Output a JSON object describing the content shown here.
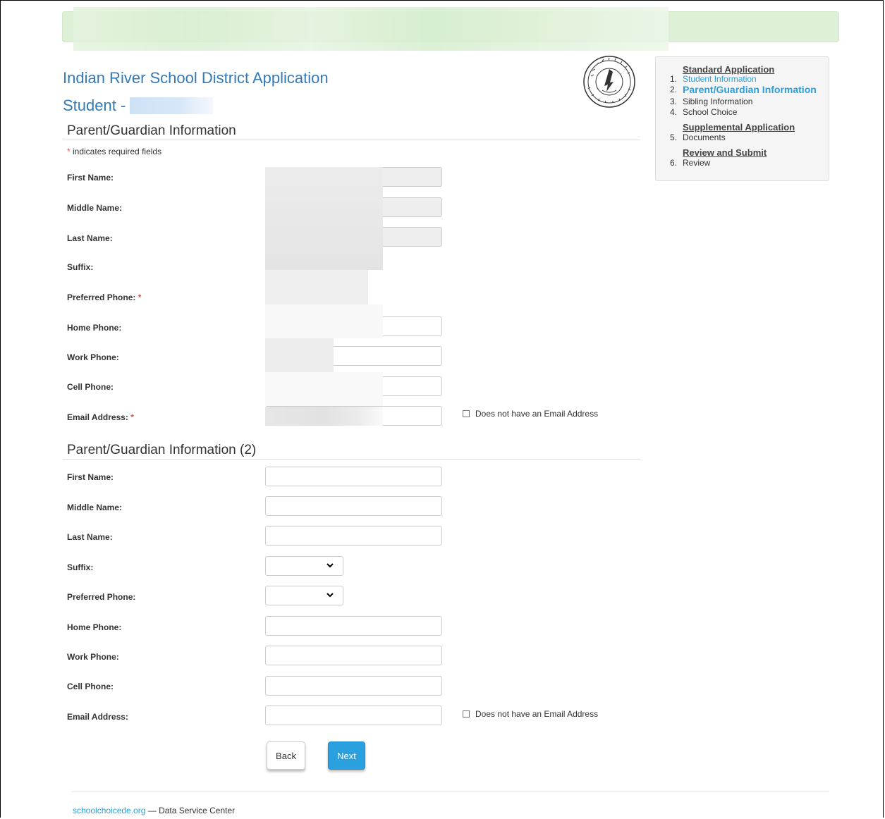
{
  "app": {
    "title": "Indian River School District Application",
    "student_prefix": "Student -"
  },
  "form": {
    "required_note_star": "*",
    "required_note_text": " indicates required fields",
    "section1": {
      "title": "Parent/Guardian Information",
      "labels": {
        "first_name": "First Name:",
        "middle_name": "Middle Name:",
        "last_name": "Last Name:",
        "suffix": "Suffix:",
        "preferred_phone": "Preferred Phone:",
        "home_phone": "Home Phone:",
        "work_phone": "Work Phone:",
        "cell_phone": "Cell Phone:",
        "email": "Email Address:"
      },
      "required_star": "*",
      "no_email_label": "Does not have an Email Address"
    },
    "section2": {
      "title": "Parent/Guardian Information (2)",
      "labels": {
        "first_name": "First Name:",
        "middle_name": "Middle Name:",
        "last_name": "Last Name:",
        "suffix": "Suffix:",
        "preferred_phone": "Preferred Phone:",
        "home_phone": "Home Phone:",
        "work_phone": "Work Phone:",
        "cell_phone": "Cell Phone:",
        "email": "Email Address:"
      },
      "no_email_label": "Does not have an Email Address"
    },
    "buttons": {
      "back": "Back",
      "next": "Next"
    }
  },
  "sidebar": {
    "standard_heading": "Standard Application",
    "supplemental_heading": "Supplemental Application",
    "review_heading": "Review and Submit",
    "steps": [
      {
        "num": "1.",
        "label": "Student Information"
      },
      {
        "num": "2.",
        "label": "Parent/Guardian Information"
      },
      {
        "num": "3.",
        "label": "Sibling Information"
      },
      {
        "num": "4.",
        "label": "School Choice"
      },
      {
        "num": "5.",
        "label": "Documents"
      },
      {
        "num": "6.",
        "label": "Review"
      }
    ]
  },
  "footer": {
    "link": "schoolchoicede.org",
    "text": " — Data Service Center"
  },
  "colors": {
    "accent": "#337ab7",
    "link": "#2aa0de",
    "banner": "#dff0d8",
    "required": "#d9534f"
  }
}
